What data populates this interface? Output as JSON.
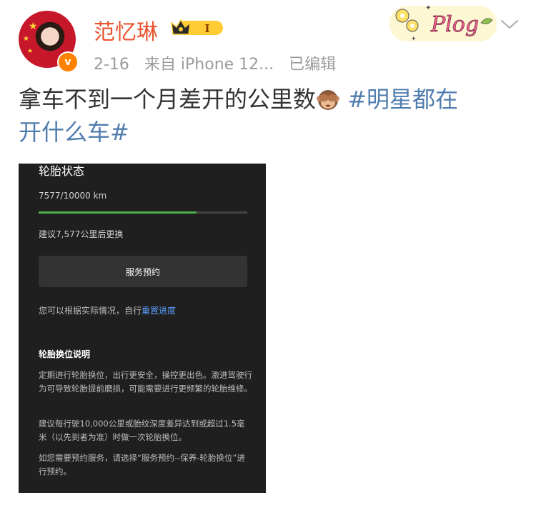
{
  "post": {
    "author": {
      "name": "范忆琳",
      "badge_icon": "vip-crown-badge",
      "badge_level": "I",
      "avatar_icon": "avatar-photo",
      "verified_icon": "verified-v-icon",
      "verified_mark": "v"
    },
    "meta": {
      "date": "2-16",
      "source": "来自 iPhone 12...",
      "edited": "已编辑"
    },
    "decoration": {
      "plog_text": "Plog",
      "icon": "plog-flower-sticker"
    },
    "menu_icon": "chevron-down-icon",
    "text": {
      "main": "拿车不到一个月差开的公里数",
      "emoji": "see-no-evil-monkey-emoji",
      "hashtag_1": "#明星都在",
      "hashtag_2": "开什么车#"
    }
  },
  "screenshot": {
    "title": "轮胎状态",
    "km_text": "7577/10000 km",
    "progress": 0.7577,
    "progress_color": "#4caf50",
    "advice": "建议7,577公里后更换",
    "service_button": "服务预约",
    "reset_prefix": "您可以根据实际情况，自行",
    "reset_link": "重置进度",
    "section_heading": "轮胎换位说明",
    "para1": "定期进行轮胎换位，出行更安全，操控更出色。激进驾驶行为可导致轮胎提前磨损，可能需要进行更频繁的轮胎维修。",
    "para2": "建议每行驶10,000公里或胎纹深度差异达到或超过1.5毫米（以先到者为准）时做一次轮胎换位。",
    "para3": "如您需要预约服务，请选择“服务预约--保养-轮胎换位”进行预约。"
  },
  "colors": {
    "username": "#e8542f",
    "hashtag": "#507daf",
    "meta": "#9b9b9b",
    "verified": "#ff8200",
    "link": "#5c9dff"
  }
}
